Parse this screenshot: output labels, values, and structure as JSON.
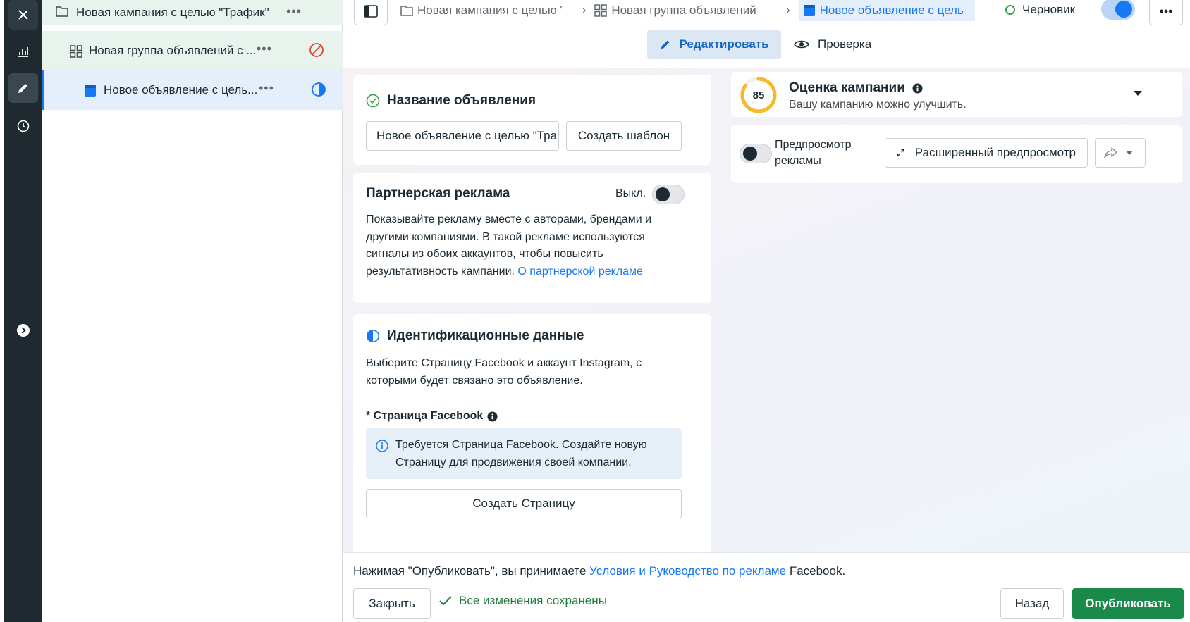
{
  "tree": {
    "campaign_label": "Новая кампания с целью \"Трафик\"",
    "adset_label": "Новая группа объявлений с ...",
    "ad_label": "Новое объявление с цель...",
    "more_glyph": "•••"
  },
  "header": {
    "breadcrumb_campaign": "Новая кампания с целью '",
    "breadcrumb_adset": "Новая группа объявлений",
    "breadcrumb_ad": "Новое объявление с цель",
    "status": "Черновик",
    "more_glyph": "•••",
    "mode_edit": "Редактировать",
    "mode_check": "Проверка"
  },
  "ad_name": {
    "title": "Название объявления",
    "input_value": "Новое объявление с целью \"Тра",
    "template_button": "Создать шаблон"
  },
  "partner": {
    "title": "Партнерская реклама",
    "toggle_label": "Выкл.",
    "description": "Показывайте рекламу вместе с авторами, брендами и другими компаниями. В такой рекламе используются сигналы из обоих аккаунтов, чтобы повысить результативность кампании.",
    "link": "О партнерской рекламе"
  },
  "identity": {
    "title": "Идентификационные данные",
    "description": "Выберите Страницу Facebook и аккаунт Instagram, с которыми будет связано это объявление.",
    "fb_page_label": "* Страница Facebook",
    "notice": "Требуется Страница Facebook. Создайте новую Страницу для продвижения своей компании.",
    "create_page_button": "Создать Страницу"
  },
  "score": {
    "value": "85",
    "value_fraction": 0.85,
    "title": "Оценка кампании",
    "subtitle": "Вашу кампанию можно улучшить."
  },
  "preview": {
    "toggle_label": "Предпросмотр рекламы",
    "advanced_button": "Расширенный предпросмотр"
  },
  "footer": {
    "terms_prefix": "Нажимая \"Опубликовать\", вы принимаете",
    "terms_link": "Условия и Руководство по рекламе",
    "terms_suffix": "Facebook.",
    "close_button": "Закрыть",
    "saved_status": "Все изменения сохранены",
    "back_button": "Назад",
    "publish_button": "Опубликовать"
  },
  "colors": {
    "accent": "#1877f2",
    "publish": "#1a8a4a",
    "rail": "#1f2a30",
    "success": "#31a24c",
    "error": "#e04438"
  }
}
